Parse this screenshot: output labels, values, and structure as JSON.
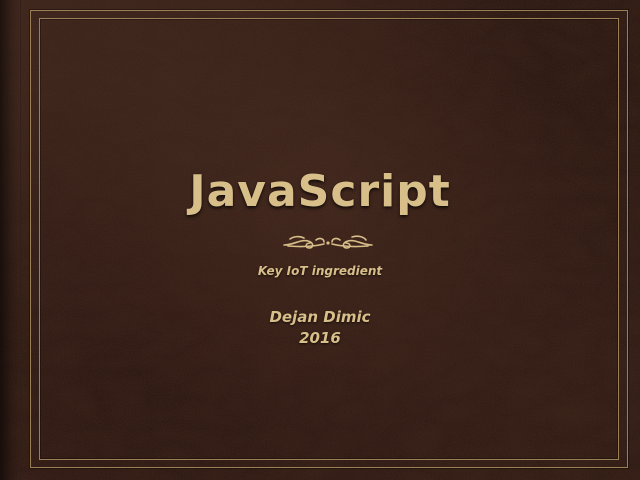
{
  "slide": {
    "title": "JavaScript",
    "subtitle": "Key IoT ingredient",
    "author": "Dejan Dimic",
    "year": "2016"
  },
  "decoration": {
    "ornament_icon": "flourish-divider-icon",
    "texture": "leather",
    "frame": "double-border",
    "colors": {
      "leather": "#311b14",
      "gold": "#d8bf8a",
      "frame": "#9a7f57"
    }
  }
}
